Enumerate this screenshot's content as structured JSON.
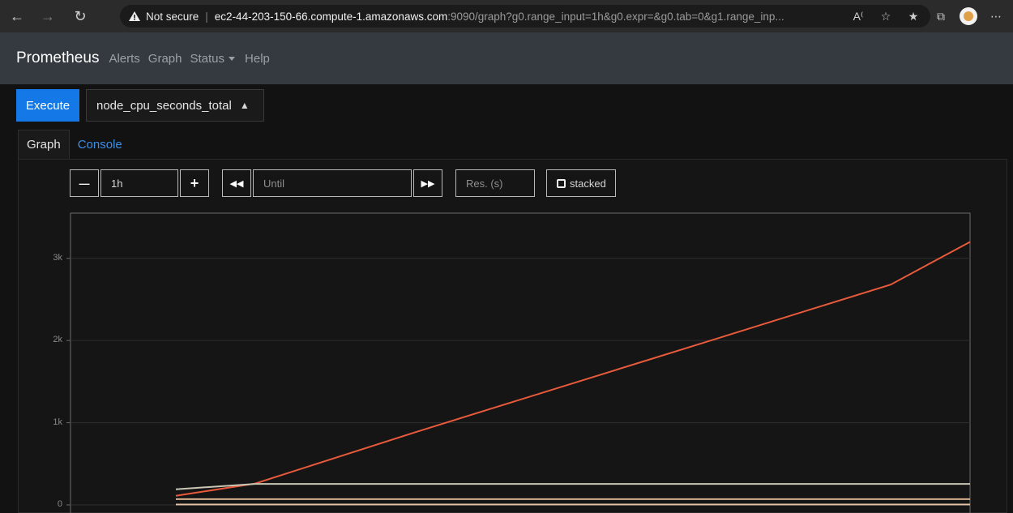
{
  "browser": {
    "not_secure_label": "Not secure",
    "url_host": "ec2-44-203-150-66.compute-1.amazonaws.com",
    "url_rest": ":9090/graph?g0.range_input=1h&g0.expr=&g0.tab=0&g1.range_inp...",
    "icons": [
      "back-icon",
      "forward-icon",
      "refresh-icon",
      "warning-icon",
      "read-aloud-icon",
      "favorite-icon",
      "favorites-list-icon",
      "collections-icon",
      "profile-avatar",
      "more-icon"
    ]
  },
  "app_nav": {
    "brand": "Prometheus",
    "links": [
      "Alerts",
      "Graph",
      "Status",
      "Help"
    ]
  },
  "query": {
    "execute_label": "Execute",
    "metric_value": "node_cpu_seconds_total"
  },
  "tabs": {
    "graph_label": "Graph",
    "console_label": "Console"
  },
  "controls": {
    "range_value": "1h",
    "until_placeholder": "Until",
    "res_placeholder": "Res. (s)",
    "stacked_label": "stacked"
  },
  "colors": {
    "execute": "#1479e6",
    "link": "#3b8fe8",
    "series_orange": "#e85a3c",
    "series_gray": "#c9c6b4",
    "series_light": "#e3c2a6",
    "series_tan": "#d4b08c"
  },
  "chart_data": {
    "type": "line",
    "grid": true,
    "yticks": [
      "3k",
      "2k",
      "1k",
      "0"
    ],
    "ylim": [
      0,
      3550
    ],
    "x": [
      0,
      1,
      2,
      3,
      4,
      5,
      6,
      7,
      8,
      9,
      10
    ],
    "series": [
      {
        "values": [
          110,
          260,
          570,
          880,
          1180,
          1480,
          1780,
          2080,
          2380,
          2680,
          3200
        ],
        "color": "#e85a3c"
      },
      {
        "values": [
          190,
          255,
          255,
          255,
          255,
          255,
          255,
          255,
          255,
          255,
          255
        ],
        "color": "#c9c6b4"
      },
      {
        "values": [
          70,
          70,
          70,
          70,
          70,
          70,
          70,
          70,
          70,
          70,
          70
        ],
        "color": "#d4b08c"
      },
      {
        "values": [
          5,
          5,
          5,
          5,
          5,
          5,
          5,
          5,
          5,
          5,
          5
        ],
        "color": "#e3c2a6"
      }
    ]
  }
}
